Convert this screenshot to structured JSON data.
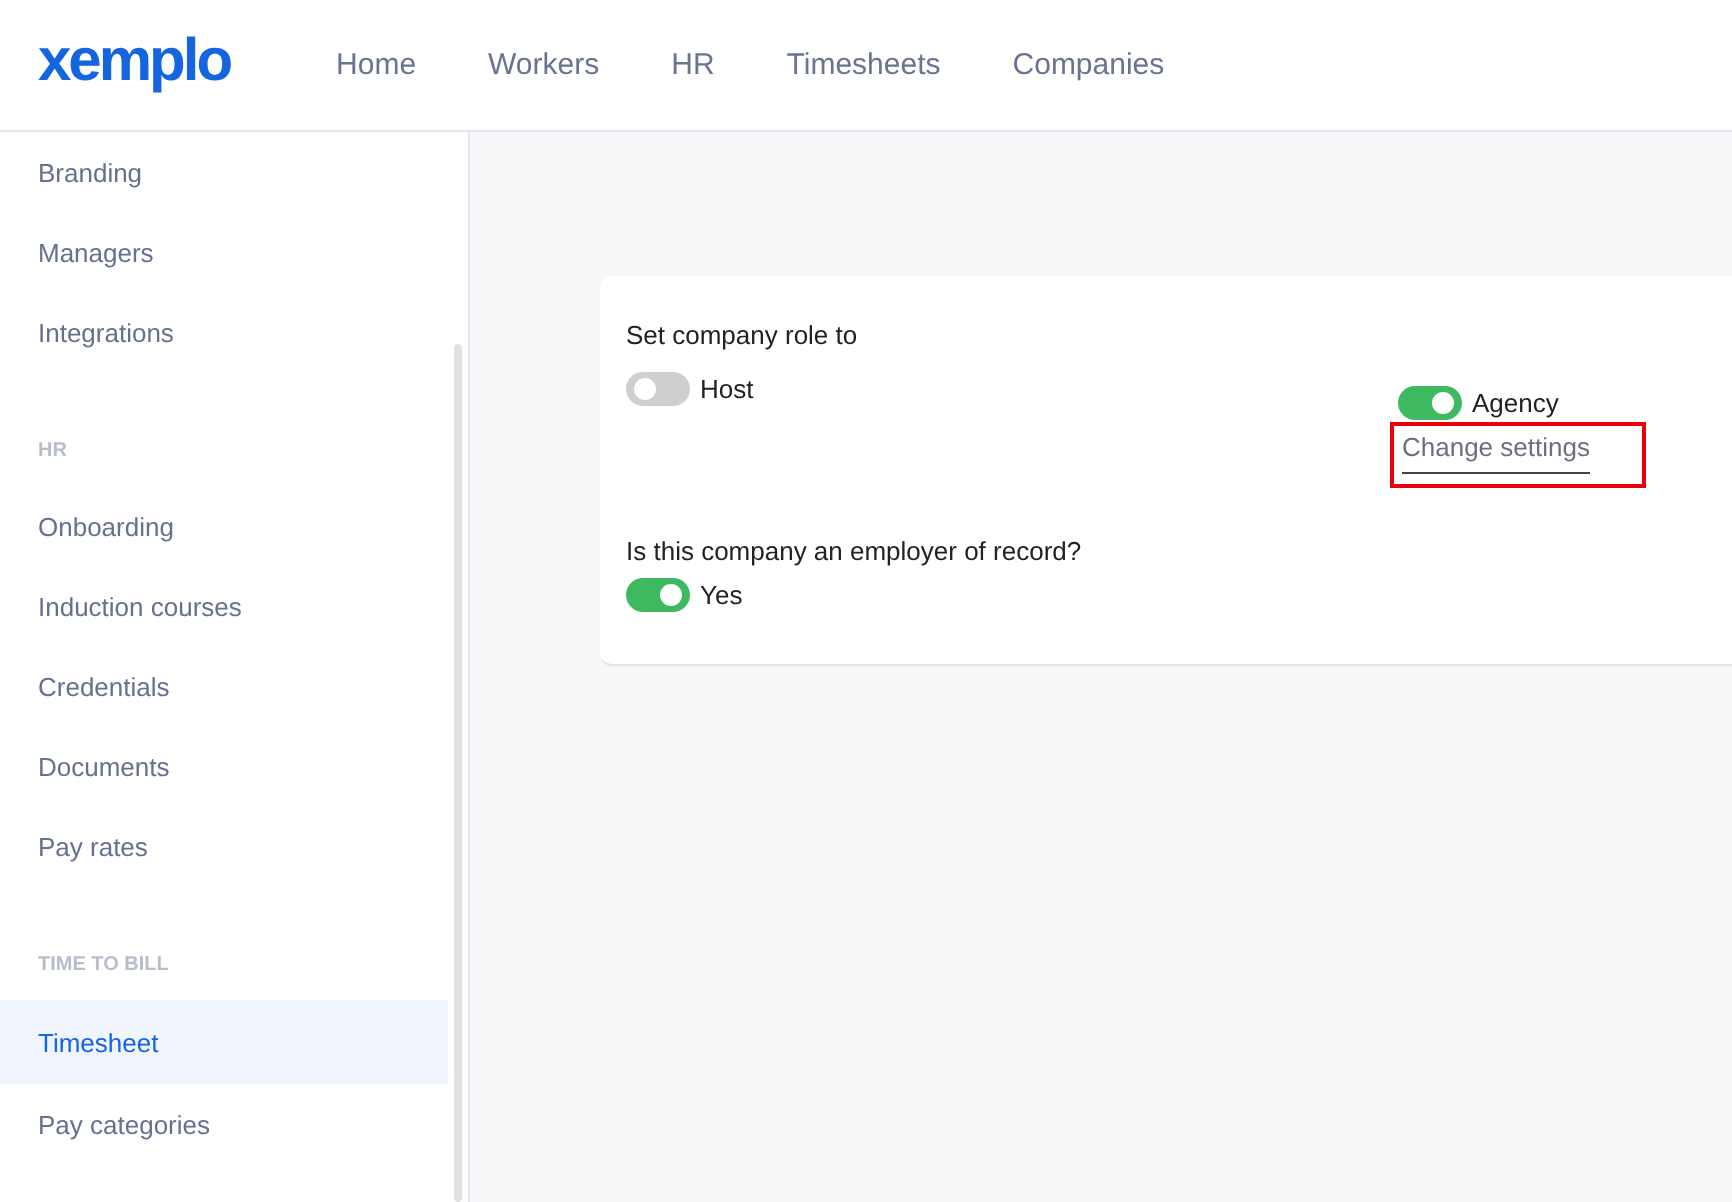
{
  "logo": "xemplo",
  "nav": [
    {
      "label": "Home",
      "selected": false
    },
    {
      "label": "Workers",
      "selected": false
    },
    {
      "label": "HR",
      "selected": false
    },
    {
      "label": "Timesheets",
      "selected": false
    },
    {
      "label": "Companies",
      "selected": false
    }
  ],
  "sidebar": [
    {
      "kind": "item",
      "label": "Branding",
      "selected": false
    },
    {
      "kind": "item",
      "label": "Managers",
      "selected": false
    },
    {
      "kind": "item",
      "label": "Integrations",
      "selected": false
    },
    {
      "kind": "heading",
      "label": "HR"
    },
    {
      "kind": "item",
      "label": "Onboarding",
      "selected": false
    },
    {
      "kind": "item",
      "label": "Induction courses",
      "selected": false
    },
    {
      "kind": "item",
      "label": "Credentials",
      "selected": false
    },
    {
      "kind": "item",
      "label": "Documents",
      "selected": false
    },
    {
      "kind": "item",
      "label": "Pay rates",
      "selected": false
    },
    {
      "kind": "heading",
      "label": "TIME TO BILL"
    },
    {
      "kind": "item",
      "label": "Timesheet",
      "selected": true
    },
    {
      "kind": "item",
      "label": "Pay categories",
      "selected": false
    }
  ],
  "role": {
    "label": "Set company role to",
    "options": [
      {
        "label": "Host",
        "on": false
      },
      {
        "label": "Agency",
        "on": true
      }
    ],
    "link": {
      "label": "Change settings",
      "highlighted": true
    }
  },
  "employer_of_record": {
    "label": "Is this company an employer of record?",
    "toggle": {
      "label": "Yes",
      "on": true
    }
  }
}
